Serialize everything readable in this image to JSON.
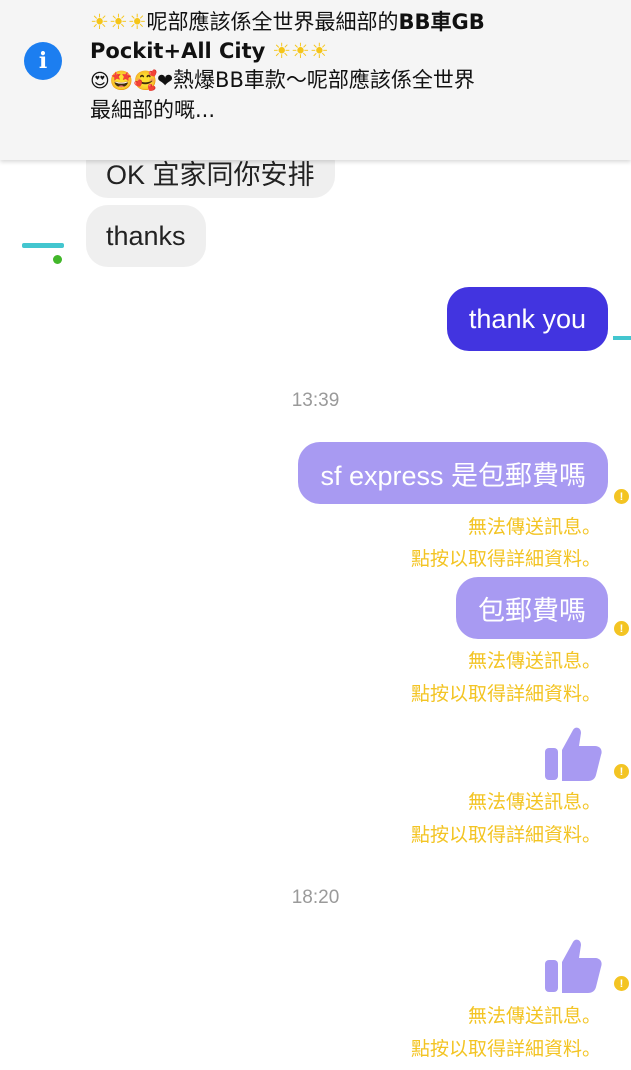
{
  "banner": {
    "stars_1": "☀☀☀",
    "title_part1": "呢部應該係全世界最細部的",
    "title_part2": "BB車GB",
    "title_line2": "Pockit+All City",
    "stars_2": "☀☀☀",
    "emojis": "😍🤩🥰❤",
    "snippet_line1": "熱爆BB車款～呢部應該係全世界",
    "snippet_line2": "最細部的嘅..."
  },
  "messages": [
    {
      "direction": "in",
      "text": "OK 宜家同你安排"
    },
    {
      "direction": "in",
      "text": "thanks"
    },
    {
      "direction": "out",
      "text": "thank you",
      "status": "sent"
    },
    {
      "direction": "timestamp",
      "text": "13:39"
    },
    {
      "direction": "out",
      "text": "sf express 是包郵費嗎",
      "status": "failed"
    },
    {
      "direction": "out",
      "text": "包郵費嗎",
      "status": "failed"
    },
    {
      "direction": "out",
      "text": "",
      "status": "failed",
      "kind": "thumbs-up"
    },
    {
      "direction": "timestamp",
      "text": "18:20"
    },
    {
      "direction": "out",
      "text": "",
      "status": "failed",
      "kind": "thumbs-up"
    }
  ],
  "error": {
    "line1": "無法傳送訊息。",
    "line2": "點按以取得詳細資料。",
    "dot": "!"
  },
  "colors": {
    "sent_bubble": "#4234e0",
    "failed_bubble": "#a89af2",
    "error_text": "#f3c423",
    "info_icon": "#1c7ef0"
  },
  "icons": {
    "info": "info-icon",
    "thumbs_up": "thumbs-up-icon",
    "error": "error-icon"
  }
}
